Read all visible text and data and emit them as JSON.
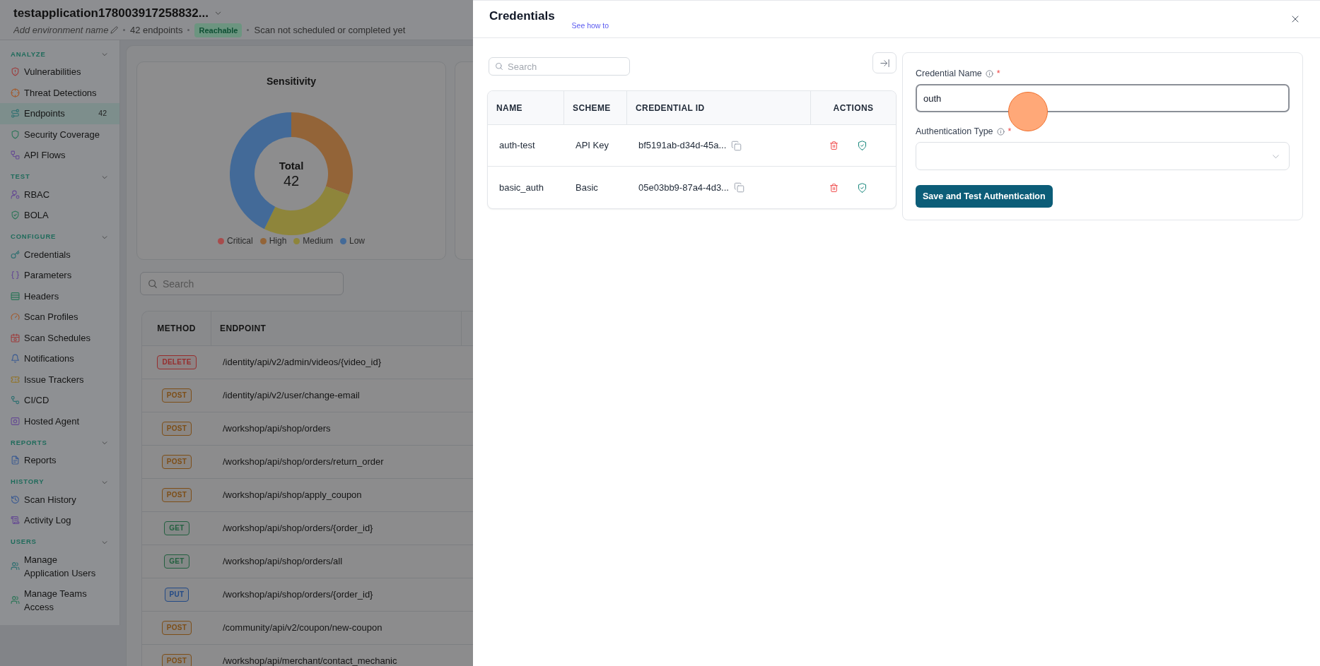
{
  "app_header": {
    "title": "testapplication178003917258832...",
    "environment_field": {
      "placeholder": "Add environment name"
    },
    "endpoint_count": "42 endpoints",
    "status_badge": "Reachable",
    "scan_status": "Scan not scheduled or completed yet"
  },
  "sidebar": {
    "sections": [
      {
        "label": "ANALYZE",
        "expanded": true,
        "items": [
          {
            "label": "Vulnerabilities",
            "selected": false
          },
          {
            "label": "Threat Detections",
            "selected": false
          },
          {
            "label": "Endpoints",
            "selected": true,
            "count": "42"
          },
          {
            "label": "Security Coverage",
            "selected": false
          },
          {
            "label": "API Flows",
            "selected": false
          }
        ]
      },
      {
        "label": "TEST",
        "expanded": true,
        "items": [
          {
            "label": "RBAC",
            "selected": false
          },
          {
            "label": "BOLA",
            "selected": false
          }
        ]
      },
      {
        "label": "CONFIGURE",
        "expanded": true,
        "items": [
          {
            "label": "Credentials",
            "selected": false
          },
          {
            "label": "Parameters",
            "selected": false
          },
          {
            "label": "Headers",
            "selected": false
          },
          {
            "label": "Scan Profiles",
            "selected": false
          },
          {
            "label": "Scan Schedules",
            "selected": false
          },
          {
            "label": "Notifications",
            "selected": false
          },
          {
            "label": "Issue Trackers",
            "selected": false
          },
          {
            "label": "CI/CD",
            "selected": false
          },
          {
            "label": "Hosted Agent",
            "selected": false
          }
        ]
      },
      {
        "label": "REPORTS",
        "expanded": true,
        "items": [
          {
            "label": "Reports",
            "selected": false
          }
        ]
      },
      {
        "label": "HISTORY",
        "expanded": true,
        "items": [
          {
            "label": "Scan History",
            "selected": false
          },
          {
            "label": "Activity Log",
            "selected": false
          }
        ]
      },
      {
        "label": "USERS",
        "expanded": true,
        "items": [
          {
            "label": "Manage Application Users",
            "selected": false
          },
          {
            "label": "Manage Teams Access",
            "selected": false
          }
        ]
      }
    ]
  },
  "dashboard": {
    "sensitivity_card": {
      "title": "Sensitivity",
      "center_label": "Total",
      "center_value": "42",
      "legend": [
        {
          "label": "Critical",
          "color": "#a84c4c"
        },
        {
          "label": "High",
          "color": "#936438"
        },
        {
          "label": "Medium",
          "color": "#8e853b"
        },
        {
          "label": "Low",
          "color": "#436a98"
        }
      ]
    },
    "search": {
      "placeholder": "Search"
    },
    "endpoints_table": {
      "columns": [
        "METHOD",
        "ENDPOINT"
      ],
      "rows": [
        {
          "method": "DELETE",
          "color": "#962d2d",
          "endpoint": "/identity/api/v2/admin/videos/{video_id}"
        },
        {
          "method": "POST",
          "color": "#7d4e17",
          "endpoint": "/identity/api/v2/user/change-email"
        },
        {
          "method": "POST",
          "color": "#7d4e17",
          "endpoint": "/workshop/api/shop/orders"
        },
        {
          "method": "POST",
          "color": "#7d4e17",
          "endpoint": "/workshop/api/shop/orders/return_order"
        },
        {
          "method": "POST",
          "color": "#7d4e17",
          "endpoint": "/workshop/api/shop/apply_coupon"
        },
        {
          "method": "GET",
          "color": "#22603f",
          "endpoint": "/workshop/api/shop/orders/{order_id}"
        },
        {
          "method": "GET",
          "color": "#22603f",
          "endpoint": "/workshop/api/shop/orders/all"
        },
        {
          "method": "PUT",
          "color": "#234a86",
          "endpoint": "/workshop/api/shop/orders/{order_id}"
        },
        {
          "method": "POST",
          "color": "#7d4e17",
          "endpoint": "/community/api/v2/coupon/new-coupon"
        },
        {
          "method": "POST",
          "color": "#7d4e17",
          "endpoint": "/workshop/api/merchant/contact_mechanic"
        }
      ]
    }
  },
  "credentials_drawer": {
    "title": "Credentials",
    "help_link": "See how to",
    "search": {
      "placeholder": "Search"
    },
    "table": {
      "columns": [
        "NAME",
        "SCHEME",
        "CREDENTIAL ID",
        "ACTIONS"
      ],
      "rows": [
        {
          "name": "auth-test",
          "scheme": "API Key",
          "credential_id": "bf5191ab-d34d-45a..."
        },
        {
          "name": "basic_auth",
          "scheme": "Basic",
          "credential_id": "05e03bb9-87a4-4d3..."
        }
      ]
    },
    "form": {
      "fields": [
        {
          "kind": "text",
          "label": "Credential Name",
          "required_mark": "*",
          "value": "outh",
          "focused": true
        },
        {
          "kind": "select",
          "label": "Authentication Type",
          "required_mark": "*",
          "focused": false
        }
      ],
      "submit_button": "Save and Test Authentication"
    }
  }
}
